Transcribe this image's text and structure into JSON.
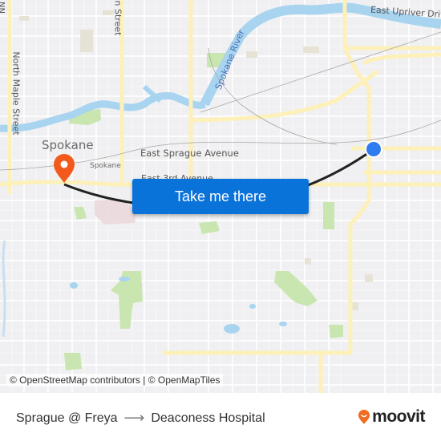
{
  "map": {
    "labels": {
      "city": "Spokane",
      "city_small": "Spokane",
      "east_sprague": "East Sprague Avenue",
      "east_3rd": "East 3rd Avenue",
      "north_maple": "North Maple Street",
      "division_partial": "n Street",
      "top_left_partial": "NN",
      "spokane_river": "Spokane River",
      "east_upriver": "East Upriver Drive"
    },
    "colors": {
      "background": "#f0f0f2",
      "road_major": "#fdf0b8",
      "water": "#a8d4f0",
      "park": "#c9e6b0",
      "route_line": "#222222",
      "origin_marker": "#2f7bf0",
      "destination_marker": "#f25a1c"
    },
    "origin": {
      "name": "Sprague @ Freya",
      "marker": "current-location-dot"
    },
    "destination": {
      "name": "Deaconess Hospital",
      "marker": "map-pin"
    }
  },
  "cta": {
    "label": "Take me there"
  },
  "attribution": {
    "text": "© OpenStreetMap contributors | © OpenMapTiles"
  },
  "footer": {
    "origin": "Sprague @ Freya",
    "arrow": "⟶",
    "destination": "Deaconess Hospital",
    "brand": "moovit",
    "brand_color": "#f26b21"
  }
}
